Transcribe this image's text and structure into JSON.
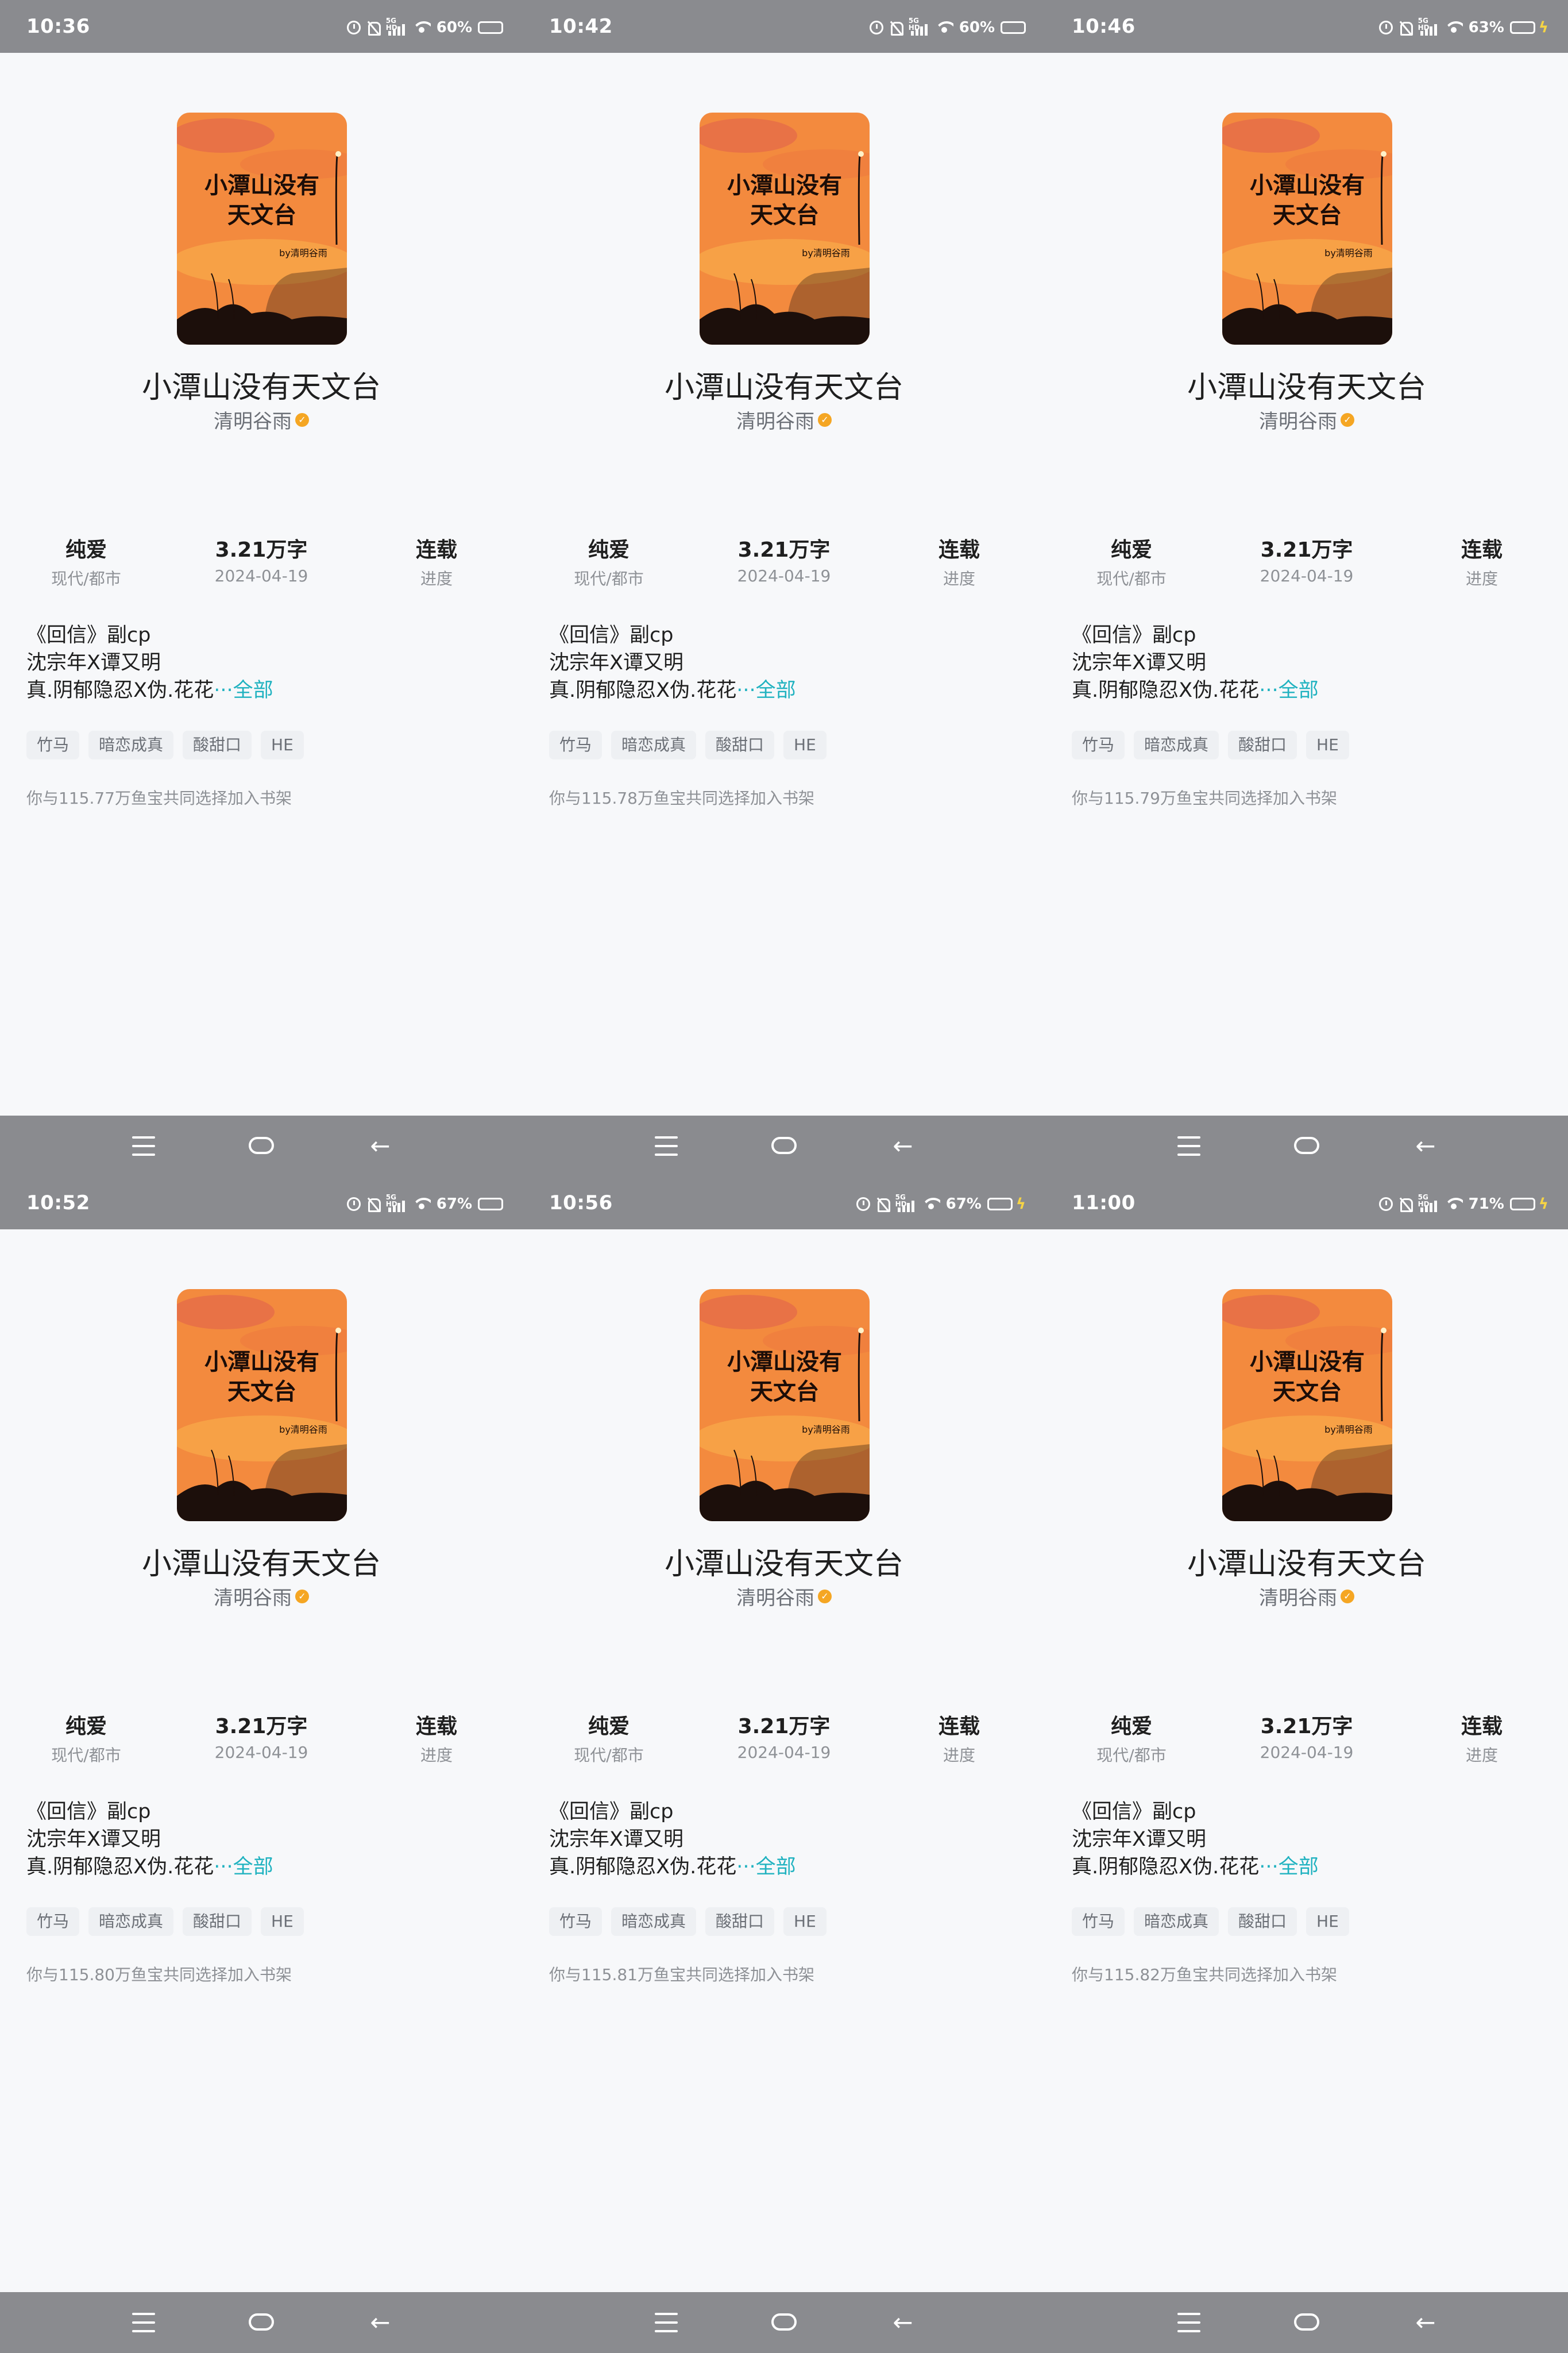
{
  "book": {
    "title": "小潭山没有天文台",
    "author": "清明谷雨",
    "cover_title_line1": "小潭山没有",
    "cover_title_line2": "天文台",
    "cover_byline": "by清明谷雨",
    "stats": {
      "category": "纯爱",
      "genre": "现代/都市",
      "words": "3.21万字",
      "date": "2024-04-19",
      "status": "连载",
      "status_label": "进度"
    },
    "summary_lines": [
      "《回信》副cp",
      "沈宗年X谭又明",
      "真.阴郁隐忍X伪.花花"
    ],
    "more_label": "···全部",
    "tags": [
      "竹马",
      "暗恋成真",
      "酸甜口",
      "HE"
    ]
  },
  "colors": {
    "accent": "#20b2c0",
    "statusbar": "#8a8b8f",
    "verified": "#f5a623",
    "charging": "#35d04a"
  },
  "icons": [
    "alarm-icon",
    "mute-icon",
    "signal-5g-icon",
    "wifi-icon",
    "battery-icon",
    "charging-icon",
    "menu-icon",
    "home-icon",
    "back-icon",
    "verified-icon"
  ],
  "screens": [
    {
      "time": "10:36",
      "battery": "60%",
      "battery_level": 0.6,
      "charging": false,
      "shelf_note": "你与115.77万鱼宝共同选择加入书架"
    },
    {
      "time": "10:42",
      "battery": "60%",
      "battery_level": 0.6,
      "charging": false,
      "shelf_note": "你与115.78万鱼宝共同选择加入书架"
    },
    {
      "time": "10:46",
      "battery": "63%",
      "battery_level": 0.63,
      "charging": true,
      "shelf_note": "你与115.79万鱼宝共同选择加入书架"
    },
    {
      "time": "10:52",
      "battery": "67%",
      "battery_level": 0.67,
      "charging": false,
      "shelf_note": "你与115.80万鱼宝共同选择加入书架"
    },
    {
      "time": "10:56",
      "battery": "67%",
      "battery_level": 0.67,
      "charging": true,
      "shelf_note": "你与115.81万鱼宝共同选择加入书架"
    },
    {
      "time": "11:00",
      "battery": "71%",
      "battery_level": 0.71,
      "charging": true,
      "shelf_note": "你与115.82万鱼宝共同选择加入书架"
    }
  ]
}
